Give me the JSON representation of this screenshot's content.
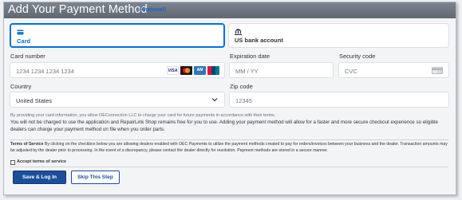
{
  "header": {
    "title": "Add Your Payment Method",
    "optional": "(Optional)"
  },
  "tabs": [
    {
      "label": "Card",
      "icon": "credit-card-icon",
      "selected": true
    },
    {
      "label": "US bank account",
      "icon": "bank-icon",
      "selected": false
    }
  ],
  "fields": {
    "card_number": {
      "label": "Card number",
      "placeholder": "1234 1234 1234 1234"
    },
    "expiration": {
      "label": "Expiration date",
      "placeholder": "MM / YY"
    },
    "security": {
      "label": "Security code",
      "placeholder": "CVC"
    },
    "country": {
      "label": "Country",
      "value": "United States"
    },
    "zip": {
      "label": "Zip code",
      "placeholder": "12345"
    }
  },
  "card_brands": [
    {
      "name": "VISA",
      "color": "#1a1f71"
    },
    {
      "name": "mastercard",
      "color": "#eb001b"
    },
    {
      "name": "AMEX",
      "color": "#2e77bc"
    },
    {
      "name": "UnionPay",
      "color": "#e21836"
    }
  ],
  "consent_text": "By providing your card information, you allow OEConnection LLC to charge your card for future payments in accordance with their terms.",
  "info_text": "You will not be charged to use the application and RepairLink Shop remains free for you to use. Adding your payment method will allow for a faster and more secure checkout experience so eligible dealers can charge your payment method on file when you order parts.",
  "tos": {
    "heading": "Terms of Service",
    "body": "By clicking on the checkbox below you are allowing dealers enabled with OEC Payments to utilize the payment methods created to pay for orders/invoices between your business and the dealer. Transaction amounts may be adjusted by the dealer prior to processing. In the event of a discrepancy, please contact the dealer directly for resolution. Payment methods are stored in a secure manner."
  },
  "checkbox_label": "Accept terms of service",
  "buttons": {
    "save": "Save & Log In",
    "skip": "Skip This Step"
  }
}
